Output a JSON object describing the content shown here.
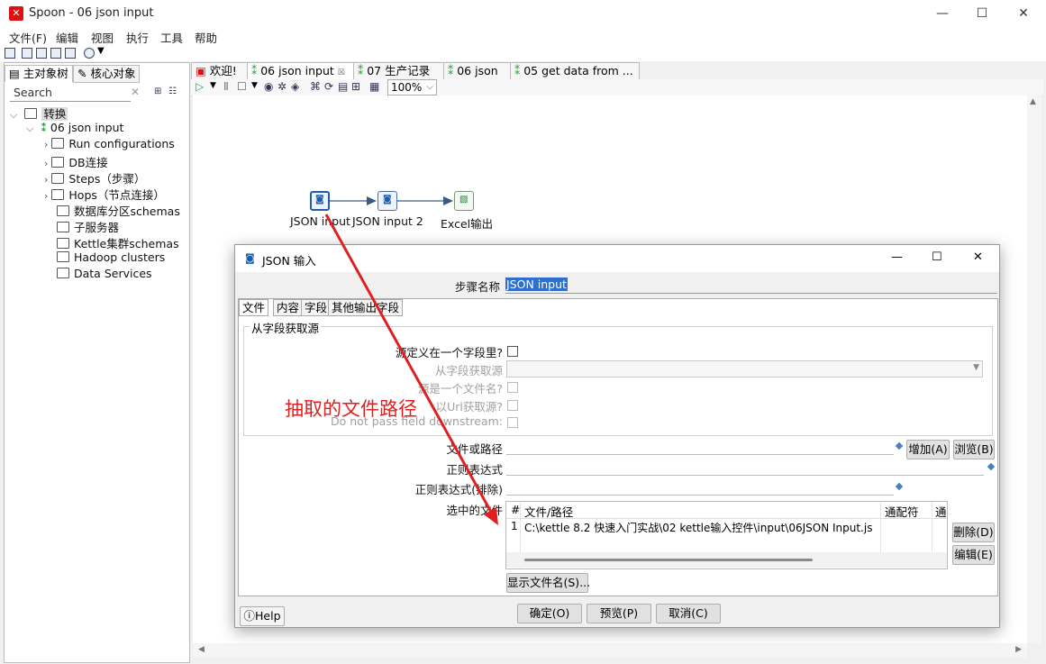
{
  "window": {
    "title": "Spoon - 06 json input",
    "logo": "✕",
    "minimize": "—",
    "maximize": "☐",
    "close": "✕"
  },
  "menu": [
    "文件(F)",
    "编辑",
    "视图",
    "执行",
    "工具",
    "帮助"
  ],
  "left": {
    "tabs": [
      "主对象树",
      "核心对象"
    ],
    "search_placeholder": "Search",
    "search_clear": "✕",
    "tree": {
      "root": "转换",
      "transform": "06 json input",
      "items": [
        "Run configurations",
        "DB连接",
        "Steps（步骤）",
        "Hops（节点连接）",
        "数据库分区schemas",
        "子服务器",
        "Kettle集群schemas",
        "Hadoop clusters",
        "Data Services"
      ]
    }
  },
  "tabs": [
    {
      "label": "欢迎!"
    },
    {
      "label": "06 json input"
    },
    {
      "label": "07 生产记录"
    },
    {
      "label": "06 json"
    },
    {
      "label": "05 get data from ..."
    }
  ],
  "zoom": "100%",
  "canvas": {
    "nodes": [
      "JSON input",
      "JSON input 2",
      "Excel输出"
    ]
  },
  "dialog": {
    "title": "JSON 输入",
    "step_name_label": "步骤名称",
    "step_name_value": "JSON input",
    "tabs": [
      "文件",
      "内容",
      "字段",
      "其他输出字段"
    ],
    "group_title": "从字段获取源",
    "source_in_field": "源定义在一个字段里?",
    "get_source_from_field": "从字段获取源",
    "source_is_filename": "源是一个文件名?",
    "read_source_as_url": "以Url获取源?",
    "do_not_pass_field": "Do not pass field downstream:",
    "file_or_dir_label": "文件或路径",
    "add_button": "增加(A)",
    "browse_button": "浏览(B)",
    "regex_label": "正则表达式",
    "regex_exclude_label": "正则表达式(排除)",
    "selected_files_label": "选中的文件",
    "table": {
      "headers": [
        "#",
        "文件/路径",
        "通配符",
        "通"
      ],
      "rows": [
        [
          "1",
          "C:\\kettle 8.2 快速入门实战\\02 kettle输入控件\\input\\06JSON Input.js",
          "",
          ""
        ]
      ]
    },
    "delete_button": "删除(D)",
    "edit_button": "编辑(E)",
    "show_filenames_button": "显示文件名(S)...",
    "help_button": "Help",
    "ok_button": "确定(O)",
    "preview_button": "预览(P)",
    "cancel_button": "取消(C)"
  },
  "annotation": {
    "text": "抽取的文件路径",
    "color": "#e02020"
  }
}
